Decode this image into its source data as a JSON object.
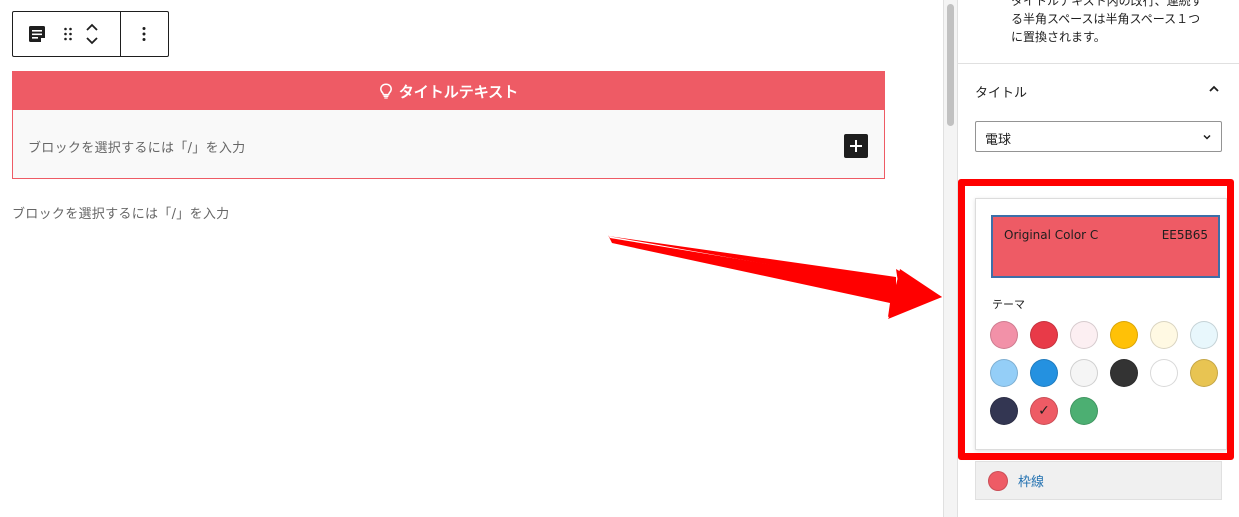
{
  "editor": {
    "title_block": {
      "heading": "タイトルテキスト",
      "inner_placeholder": "ブロックを選択するには「/」を入力"
    },
    "outer_placeholder": "ブロックを選択するには「/」を入力"
  },
  "sidebar": {
    "help_text_lines": [
      "タイトルテキスト内の改行、連続す",
      "る半角スペースは半角スペース１つ",
      "に置換されます。"
    ],
    "panel_title": "タイトル",
    "icon_select": {
      "value": "電球"
    },
    "color_control": {
      "label": "枠線",
      "color": "#EE5B65"
    }
  },
  "color_popover": {
    "current": {
      "name": "Original Color C",
      "hex": "EE5B65"
    },
    "theme_label": "テーマ",
    "palette": [
      {
        "color": "#F291A8",
        "selected": false
      },
      {
        "color": "#E83A48",
        "selected": false
      },
      {
        "color": "#FCEFF2",
        "selected": false
      },
      {
        "color": "#FFC107",
        "selected": false
      },
      {
        "color": "#FFF9E3",
        "selected": false
      },
      {
        "color": "#E8F7FC",
        "selected": false
      },
      {
        "color": "#94CEF7",
        "selected": false
      },
      {
        "color": "#2491E0",
        "selected": false
      },
      {
        "color": "#F5F5F5",
        "selected": false
      },
      {
        "color": "#333333",
        "selected": false
      },
      {
        "color": "#FFFFFF",
        "selected": false
      },
      {
        "color": "#E8C452",
        "selected": false
      },
      {
        "color": "#333652",
        "selected": false
      },
      {
        "color": "#EE5B65",
        "selected": true
      },
      {
        "color": "#4CAF72",
        "selected": false
      }
    ]
  },
  "colors": {
    "accent": "#EE5B65",
    "highlight": "#FF0000",
    "arrow": "#FF0000"
  }
}
